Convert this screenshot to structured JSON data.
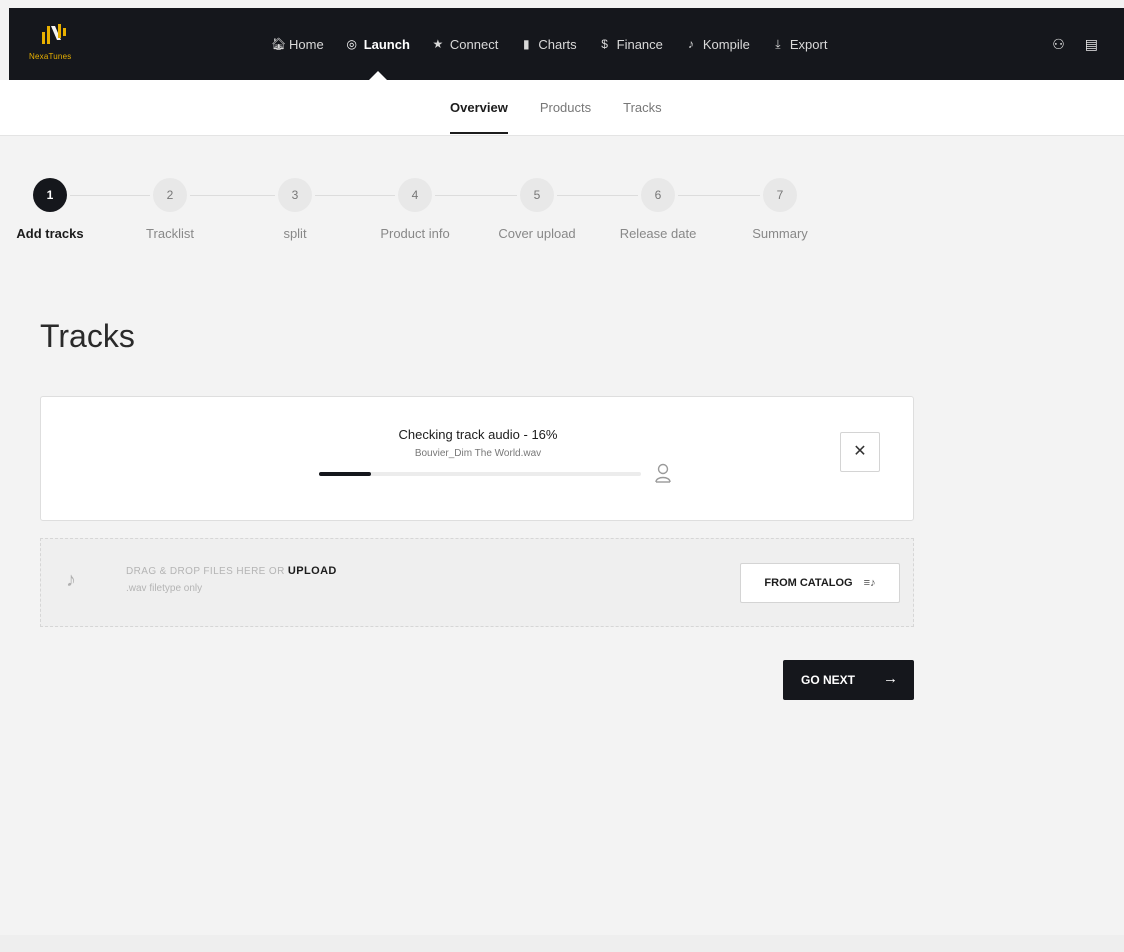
{
  "brand": {
    "name": "NexaTunes",
    "logo_color": "#e8b000"
  },
  "nav": {
    "items": [
      {
        "label": "Home",
        "icon": "home-icon",
        "glyph": "🏠︎",
        "active": false
      },
      {
        "label": "Launch",
        "icon": "rocket-icon",
        "glyph": "◎",
        "active": true
      },
      {
        "label": "Connect",
        "icon": "star-icon",
        "glyph": "★",
        "active": false
      },
      {
        "label": "Charts",
        "icon": "bar-chart-icon",
        "glyph": "▮",
        "active": false
      },
      {
        "label": "Finance",
        "icon": "dollar-icon",
        "glyph": "$",
        "active": false
      },
      {
        "label": "Kompile",
        "icon": "music-note-icon",
        "glyph": "♪",
        "active": false
      },
      {
        "label": "Export",
        "icon": "download-icon",
        "glyph": "⤓",
        "active": false
      }
    ],
    "right_icons": [
      "account-icon",
      "id-card-icon"
    ]
  },
  "subnav": {
    "tabs": [
      {
        "label": "Overview",
        "active": true
      },
      {
        "label": "Products",
        "active": false
      },
      {
        "label": "Tracks",
        "active": false
      }
    ]
  },
  "stepper": {
    "steps": [
      {
        "number": "1",
        "label": "Add tracks",
        "active": true
      },
      {
        "number": "2",
        "label": "Tracklist",
        "active": false
      },
      {
        "number": "3",
        "label": "split",
        "active": false
      },
      {
        "number": "4",
        "label": "Product info",
        "active": false
      },
      {
        "number": "5",
        "label": "Cover upload",
        "active": false
      },
      {
        "number": "6",
        "label": "Release date",
        "active": false
      },
      {
        "number": "7",
        "label": "Summary",
        "active": false
      }
    ]
  },
  "main": {
    "title": "Tracks",
    "upload": {
      "status": "Checking track audio - 16%",
      "filename": "Bouvier_Dim The World.wav",
      "progress": 0.16,
      "close_label": "✕"
    },
    "dropzone": {
      "text": "DRAG & DROP FILES HERE OR ",
      "upload_label": "UPLOAD",
      "subtext": ".wav filetype only",
      "catalog_label": "FROM CATALOG"
    },
    "go_next_label": "GO NEXT",
    "go_next_arrow": "→"
  },
  "colors": {
    "dark": "#15171c",
    "background": "#f3f3f3",
    "accent": "#e8b000"
  }
}
